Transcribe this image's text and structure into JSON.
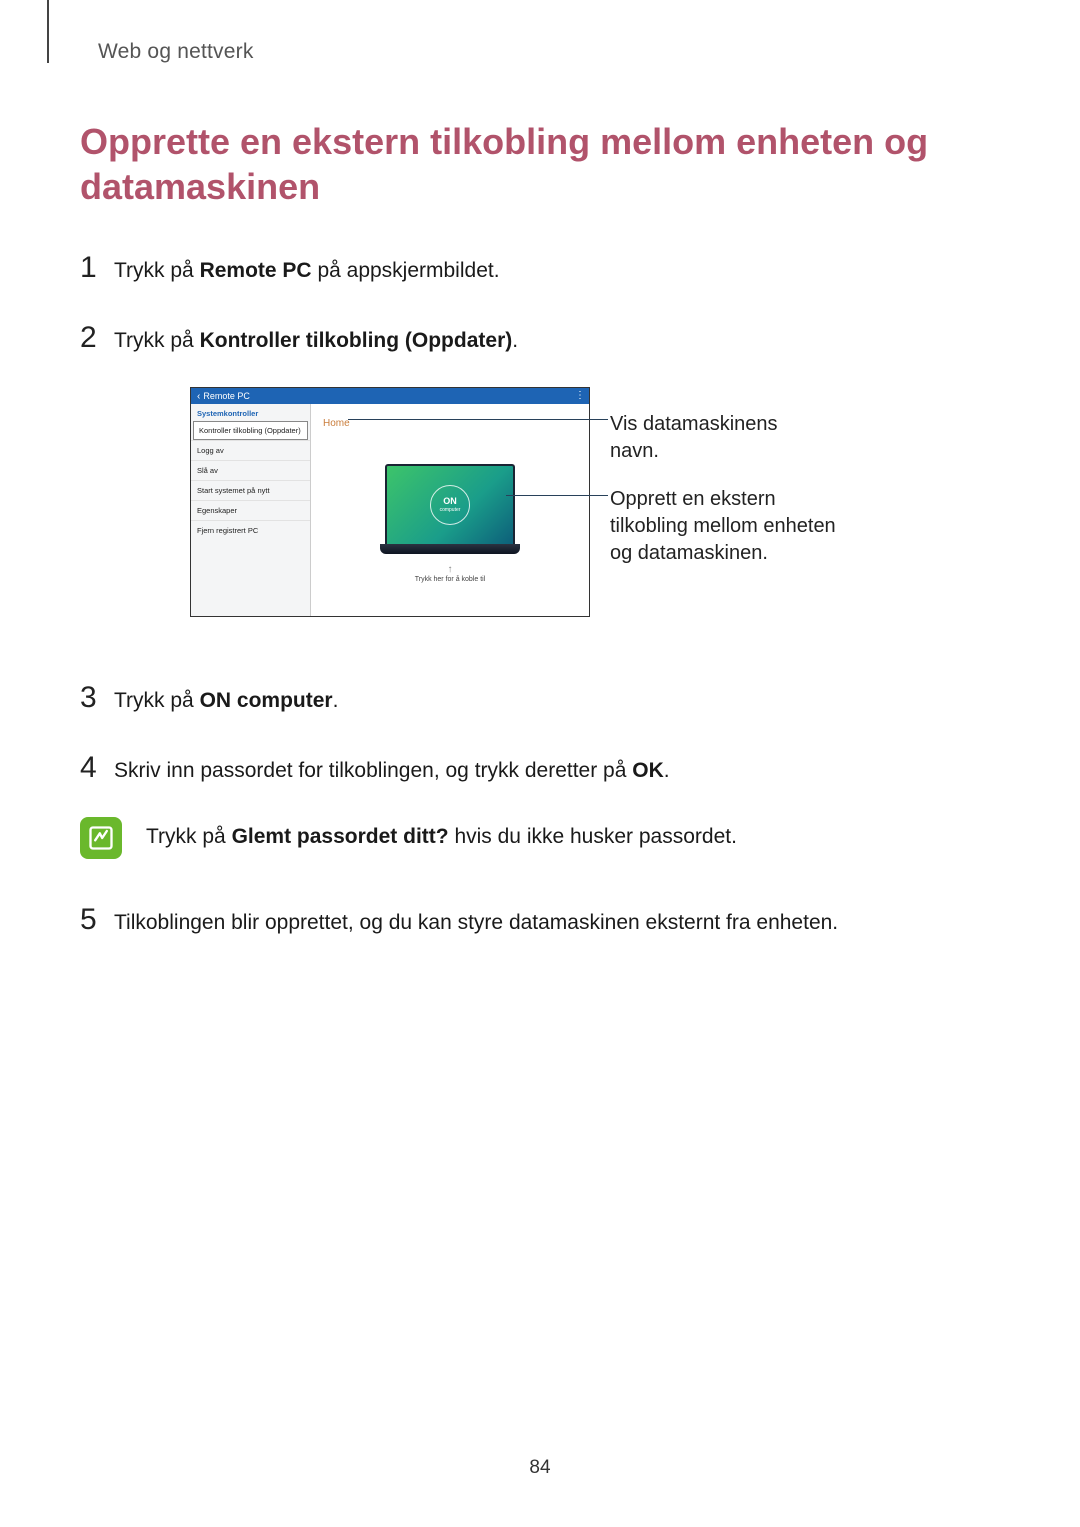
{
  "header": {
    "section": "Web og nettverk"
  },
  "title": "Opprette en ekstern tilkobling mellom enheten og datamaskinen",
  "steps": {
    "s1": {
      "num": "1",
      "pre": "Trykk på ",
      "bold": "Remote PC",
      "post": " på appskjermbildet."
    },
    "s2": {
      "num": "2",
      "pre": "Trykk på ",
      "bold": "Kontroller tilkobling (Oppdater)",
      "post": "."
    },
    "s3": {
      "num": "3",
      "pre": "Trykk på ",
      "bold": "ON computer",
      "post": "."
    },
    "s4": {
      "num": "4",
      "pre": "Skriv inn passordet for tilkoblingen, og trykk deretter på ",
      "bold": "OK",
      "post": "."
    },
    "s5": {
      "num": "5",
      "text": "Tilkoblingen blir opprettet, og du kan styre datamaskinen eksternt fra enheten."
    }
  },
  "figure": {
    "header_title": "Remote PC",
    "sidebar_title": "Systemkontroller",
    "sidebar_items": {
      "i0": "Kontroller tilkobling (Oppdater)",
      "i1": "Logg av",
      "i2": "Slå av",
      "i3": "Start systemet på nytt",
      "i4": "Egenskaper",
      "i5": "Fjern registrert PC"
    },
    "home_label": "Home",
    "on_label": "ON",
    "on_sub": "computer",
    "tap_hint": "Trykk her for å koble til",
    "callout1": "Vis datamaskinens navn.",
    "callout2": "Opprett en ekstern tilkobling mellom enheten og datamaskinen."
  },
  "note": {
    "pre": "Trykk på ",
    "bold": "Glemt passordet ditt?",
    "post": " hvis du ikke husker passordet."
  },
  "page_number": "84"
}
